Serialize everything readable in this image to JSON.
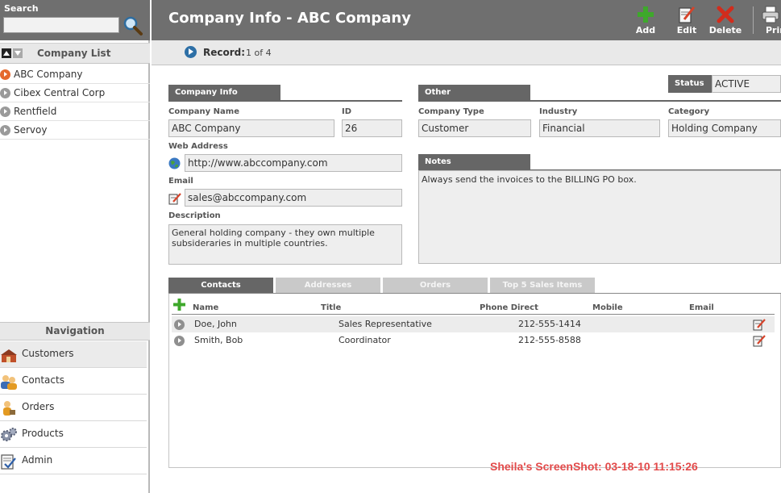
{
  "search": {
    "label": "Search",
    "value": ""
  },
  "company_list": {
    "title": "Company List",
    "items": [
      {
        "label": "ABC Company",
        "active": true
      },
      {
        "label": "Cibex Central Corp",
        "active": false
      },
      {
        "label": "Rentfield",
        "active": false
      },
      {
        "label": "Servoy",
        "active": false
      }
    ]
  },
  "navigation": {
    "title": "Navigation",
    "items": [
      {
        "label": "Customers",
        "icon": "customers-icon"
      },
      {
        "label": "Contacts",
        "icon": "contacts-icon"
      },
      {
        "label": "Orders",
        "icon": "orders-icon"
      },
      {
        "label": "Products",
        "icon": "products-icon"
      },
      {
        "label": "Admin",
        "icon": "admin-icon"
      }
    ]
  },
  "header": {
    "title": "Company Info - ABC Company",
    "toolbar": {
      "add": "Add",
      "edit": "Edit",
      "delete": "Delete",
      "print": "Prin"
    }
  },
  "record": {
    "label": "Record:",
    "count": "1 of 4"
  },
  "company_info": {
    "section_title": "Company Info",
    "company_name_label": "Company Name",
    "company_name": "ABC Company",
    "id_label": "ID",
    "id": "26",
    "web_label": "Web Address",
    "web": "http://www.abccompany.com",
    "email_label": "Email",
    "email": "sales@abccompany.com",
    "description_label": "Description",
    "description": "General holding company - they own multiple subsideraries in multiple countries."
  },
  "other": {
    "section_title": "Other",
    "status_label": "Status",
    "status": "ACTIVE",
    "company_type_label": "Company Type",
    "company_type": "Customer",
    "industry_label": "Industry",
    "industry": "Financial",
    "category_label": "Category",
    "category": "Holding Company",
    "notes_label": "Notes",
    "notes": "Always send the invoices to the BILLING PO box."
  },
  "tabs": [
    "Contacts",
    "Addresses",
    "Orders",
    "Top 5 Sales Items"
  ],
  "contacts_table": {
    "columns": [
      "Name",
      "Title",
      "Phone Direct",
      "Mobile",
      "Email"
    ],
    "rows": [
      {
        "name": "Doe, John",
        "title": "Sales Representative",
        "phone": "212-555-1414",
        "mobile": "",
        "email": ""
      },
      {
        "name": "Smith, Bob",
        "title": "Coordinator",
        "phone": "212-555-8588",
        "mobile": "",
        "email": ""
      }
    ]
  },
  "watermark": "Sheila's ScreenShot: 03-18-10 11:15:26",
  "colors": {
    "header_bg": "#6f6f6f",
    "section_tab": "#666666",
    "active_arrow": "#e5692e",
    "watermark": "#e34a4a",
    "add_green": "#3ea82b",
    "delete_red": "#d22c1c"
  }
}
